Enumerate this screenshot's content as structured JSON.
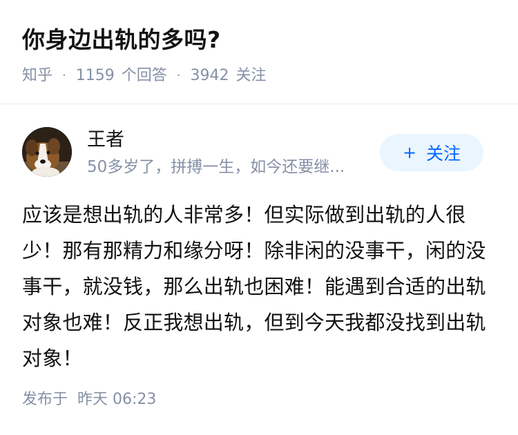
{
  "question": {
    "title": "你身边出轨的多吗?",
    "source": "知乎",
    "answer_count": "1159",
    "answer_label": "个回答",
    "follower_count": "3942",
    "follower_label": "关注",
    "separator": "·"
  },
  "author": {
    "name": "王者",
    "bio": "50多岁了，拼搏一生，如今还要继...",
    "avatar_icon": "dog-avatar-icon",
    "follow_label": "关注",
    "follow_icon": "+"
  },
  "answer": {
    "content": "应该是想出轨的人非常多！但实际做到出轨的人很少！那有那精力和缘分呀！除非闲的没事干，闲的没事干，就没钱，那么出轨也困难！能遇到合适的出轨对象也难！反正我想出轨，但到今天我都没找到出轨对象！",
    "published_label": "发布于",
    "published_time": "昨天 06:23"
  },
  "colors": {
    "text": "#121212",
    "meta": "#8590a6",
    "accent": "#0066ff",
    "follow_bg": "#ebf5fd"
  }
}
